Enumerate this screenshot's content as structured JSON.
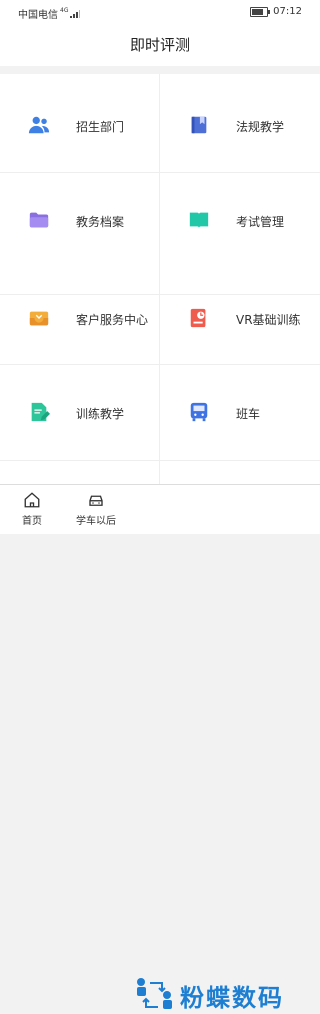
{
  "status": {
    "carrier": "中国电信",
    "network": "4G",
    "time": "07:12",
    "battery_level": 0.8
  },
  "header": {
    "title": "即时评测"
  },
  "menu": [
    {
      "label": "招生部门",
      "icon": "people-icon",
      "color": "#3f80e5"
    },
    {
      "label": "法规教学",
      "icon": "book-icon",
      "color": "#4e6fd6"
    },
    {
      "label": "教务档案",
      "icon": "folder-icon",
      "color": "#8a6fe0"
    },
    {
      "label": "考试管理",
      "icon": "open-book-icon",
      "color": "#21c7a6"
    },
    {
      "label": "客户服务中心",
      "icon": "mailbox-icon",
      "color": "#f3ad3b"
    },
    {
      "label": "VR基础训练",
      "icon": "vr-icon",
      "color": "#ef5b4c"
    },
    {
      "label": "训练教学",
      "icon": "document-edit-icon",
      "color": "#2fc59a"
    },
    {
      "label": "班车",
      "icon": "bus-icon",
      "color": "#3f72e3"
    }
  ],
  "tabs": [
    {
      "label": "首页",
      "icon": "home-icon"
    },
    {
      "label": "学车以后",
      "icon": "car-icon"
    }
  ],
  "watermark": {
    "text": "粉蝶数码"
  }
}
